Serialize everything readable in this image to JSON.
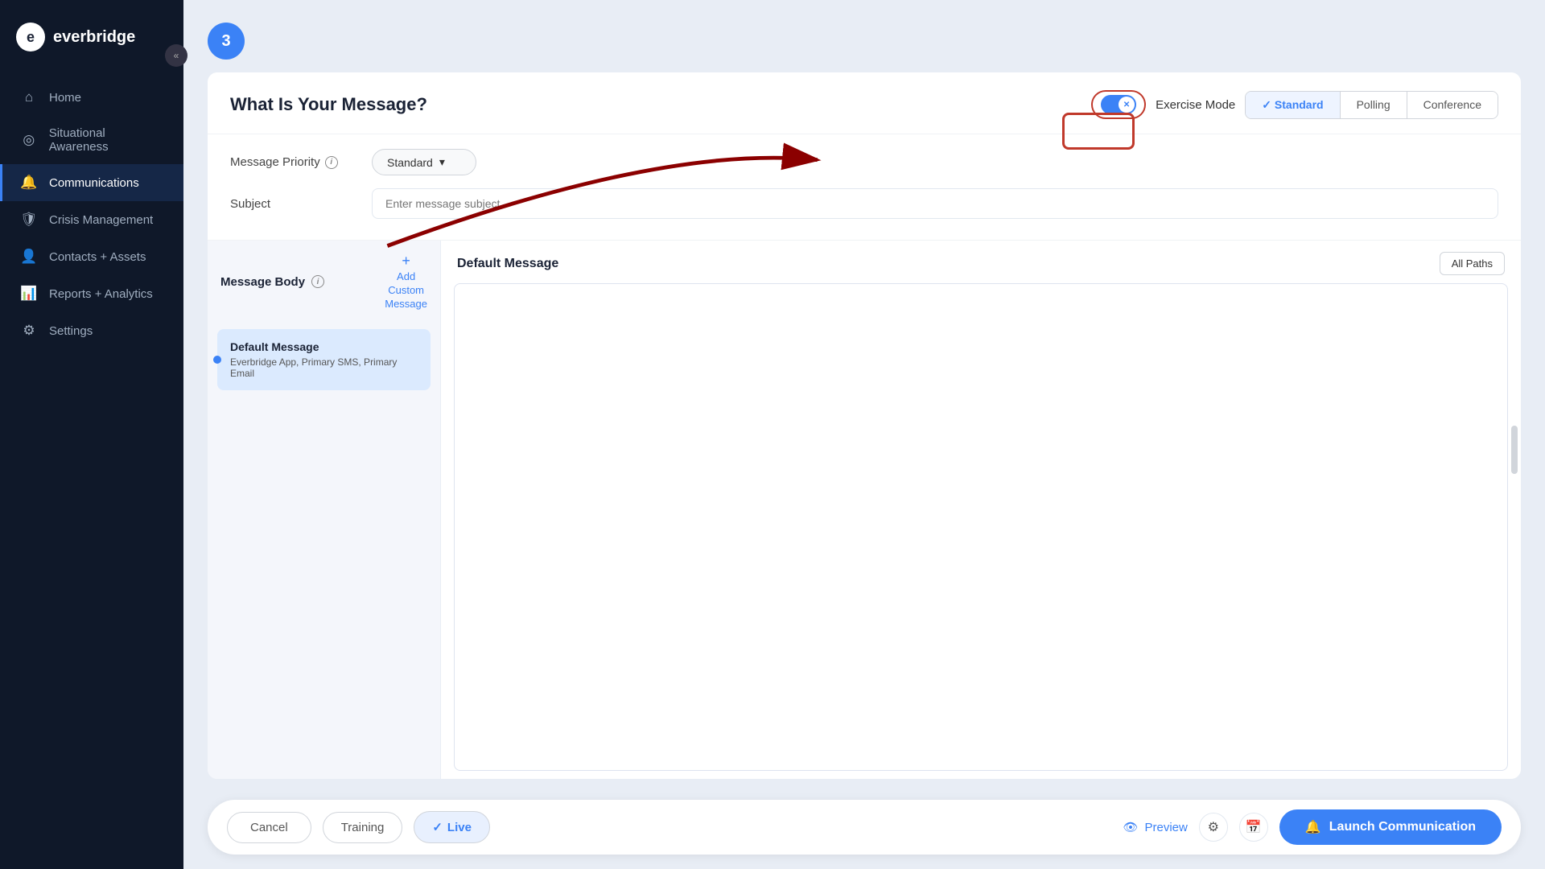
{
  "sidebar": {
    "logo_text": "everbridge",
    "collapse_icon": "«",
    "items": [
      {
        "id": "home",
        "label": "Home",
        "icon": "⌂",
        "active": false
      },
      {
        "id": "situational-awareness",
        "label": "Situational Awareness",
        "icon": "◎",
        "active": false
      },
      {
        "id": "communications",
        "label": "Communications",
        "icon": "📢",
        "active": true
      },
      {
        "id": "crisis-management",
        "label": "Crisis Management",
        "icon": "⚙",
        "active": false
      },
      {
        "id": "contacts-assets",
        "label": "Contacts + Assets",
        "icon": "👤",
        "active": false
      },
      {
        "id": "reports-analytics",
        "label": "Reports + Analytics",
        "icon": "📊",
        "active": false
      },
      {
        "id": "settings",
        "label": "Settings",
        "icon": "⚙",
        "active": false
      }
    ]
  },
  "step": {
    "number": "3"
  },
  "header": {
    "title": "What Is Your Message?",
    "exercise_mode_label": "Exercise Mode",
    "toggle_state": "on",
    "mode_tabs": [
      {
        "id": "standard",
        "label": "Standard",
        "active": true,
        "check": true
      },
      {
        "id": "polling",
        "label": "Polling",
        "active": false,
        "check": false
      },
      {
        "id": "conference",
        "label": "Conference",
        "active": false,
        "check": false
      }
    ]
  },
  "form": {
    "priority_label": "Message Priority",
    "priority_value": "Standard",
    "subject_label": "Subject",
    "subject_placeholder": "Enter message subject"
  },
  "message_body": {
    "section_label": "Message Body",
    "add_custom_plus": "+",
    "add_custom_line1": "Add",
    "add_custom_line2": "Custom",
    "add_custom_line3": "Message",
    "messages": [
      {
        "title": "Default Message",
        "subtitle": "Everbridge App, Primary SMS, Primary Email"
      }
    ]
  },
  "right_panel": {
    "title": "Default Message",
    "all_paths_label": "All Paths"
  },
  "bottom_bar": {
    "cancel_label": "Cancel",
    "training_label": "Training",
    "live_check": "✓",
    "live_label": "Live",
    "preview_label": "Preview",
    "launch_icon": "📢",
    "launch_label": "Launch Communication"
  }
}
